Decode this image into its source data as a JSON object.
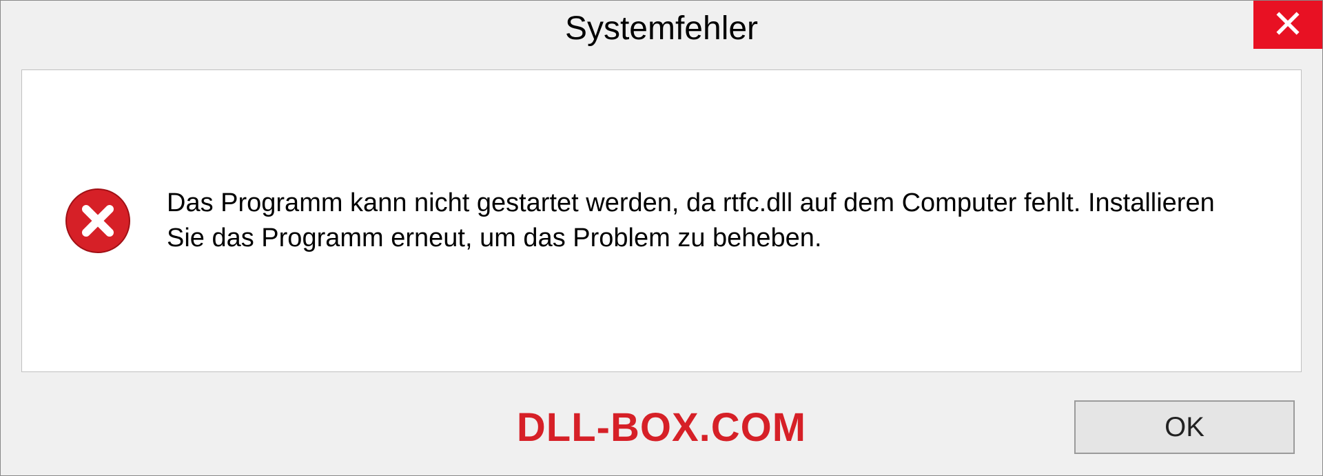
{
  "dialog": {
    "title": "Systemfehler",
    "message": "Das Programm kann nicht gestartet werden, da rtfc.dll auf dem Computer fehlt. Installieren Sie das Programm erneut, um das Problem zu beheben.",
    "ok_label": "OK"
  },
  "watermark": "DLL-BOX.COM",
  "colors": {
    "close_bg": "#e81123",
    "error_red": "#d62027",
    "watermark_red": "#d62027"
  }
}
